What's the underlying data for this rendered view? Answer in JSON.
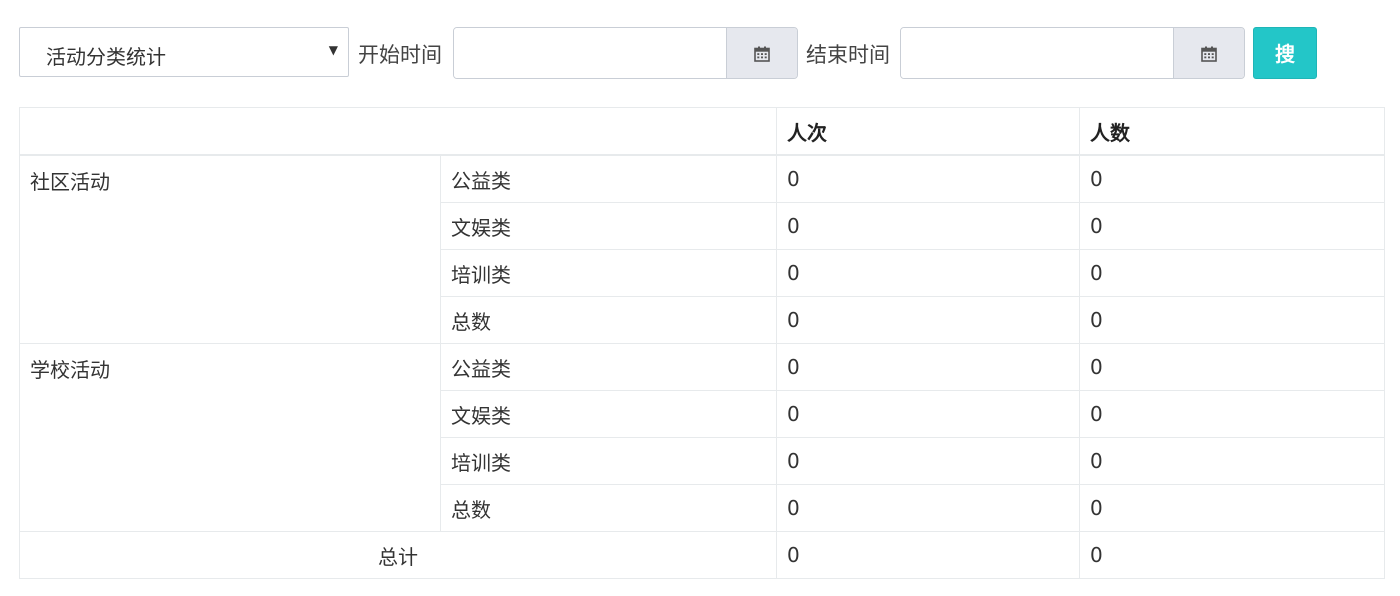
{
  "toolbar": {
    "category_select": {
      "value": "活动分类统计"
    },
    "start_label": "开始时间",
    "start_input": {
      "value": "",
      "placeholder": ""
    },
    "end_label": "结束时间",
    "end_input": {
      "value": "",
      "placeholder": ""
    },
    "search_label": "搜",
    "calendar_icon": "calendar-icon",
    "accent_color": "#23c6c8"
  },
  "table": {
    "headers": {
      "blank": "",
      "visits": "人次",
      "people": "人数"
    },
    "groups": [
      {
        "name": "社区活动",
        "rows": [
          {
            "sub": "公益类",
            "visits": "0",
            "people": "0"
          },
          {
            "sub": "文娱类",
            "visits": "0",
            "people": "0"
          },
          {
            "sub": "培训类",
            "visits": "0",
            "people": "0"
          },
          {
            "sub": "总数",
            "visits": "0",
            "people": "0"
          }
        ]
      },
      {
        "name": "学校活动",
        "rows": [
          {
            "sub": "公益类",
            "visits": "0",
            "people": "0"
          },
          {
            "sub": "文娱类",
            "visits": "0",
            "people": "0"
          },
          {
            "sub": "培训类",
            "visits": "0",
            "people": "0"
          },
          {
            "sub": "总数",
            "visits": "0",
            "people": "0"
          }
        ]
      }
    ],
    "total": {
      "label": "总计",
      "visits": "0",
      "people": "0"
    }
  }
}
